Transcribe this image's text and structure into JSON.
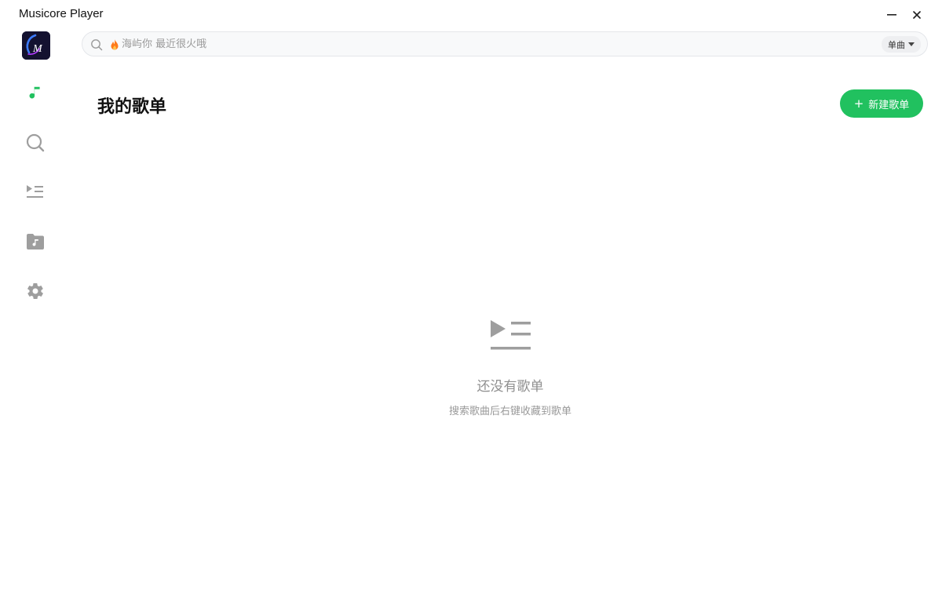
{
  "window": {
    "title": "Musicore Player",
    "minimize_icon": "minimize-icon",
    "close_icon": "close-icon"
  },
  "sidebar": {
    "logo_letter": "M",
    "items": [
      {
        "name": "playlists",
        "icon": "music-note-icon",
        "active": true
      },
      {
        "name": "search",
        "icon": "search-icon",
        "active": false
      },
      {
        "name": "queue",
        "icon": "playlist-play-icon",
        "active": false
      },
      {
        "name": "local-music",
        "icon": "music-folder-icon",
        "active": false
      },
      {
        "name": "settings",
        "icon": "gear-icon",
        "active": false
      }
    ]
  },
  "search": {
    "placeholder": "海屿你 最近很火哦",
    "hot_icon": "fire-icon",
    "type_label": "单曲"
  },
  "main": {
    "title": "我的歌单",
    "new_playlist_label": "新建歌单"
  },
  "empty_state": {
    "icon": "playlist-play-icon",
    "title": "还没有歌单",
    "hint": "搜索歌曲后右键收藏到歌单"
  },
  "colors": {
    "accent": "#21c15f",
    "icon_gray": "#9e9e9e",
    "text_muted": "#8f8f8f"
  }
}
